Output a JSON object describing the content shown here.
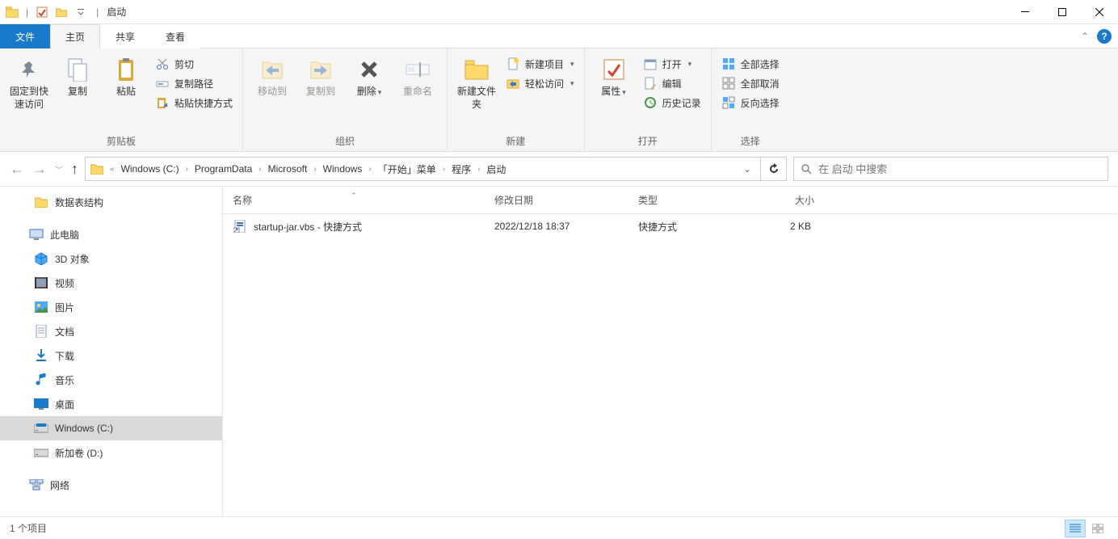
{
  "window": {
    "title": "启动"
  },
  "tabs": {
    "file": "文件",
    "home": "主页",
    "share": "共享",
    "view": "查看"
  },
  "ribbon": {
    "clipboard": {
      "group_label": "剪贴板",
      "pin": "固定到快速访问",
      "copy": "复制",
      "paste": "粘贴",
      "cut": "剪切",
      "copy_path": "复制路径",
      "paste_shortcut": "粘贴快捷方式"
    },
    "organize": {
      "group_label": "组织",
      "move_to": "移动到",
      "copy_to": "复制到",
      "delete": "删除",
      "rename": "重命名"
    },
    "new": {
      "group_label": "新建",
      "new_folder": "新建文件夹",
      "new_item": "新建项目",
      "easy_access": "轻松访问"
    },
    "open": {
      "group_label": "打开",
      "properties": "属性",
      "open": "打开",
      "edit": "编辑",
      "history": "历史记录"
    },
    "select": {
      "group_label": "选择",
      "select_all": "全部选择",
      "select_none": "全部取消",
      "invert": "反向选择"
    }
  },
  "breadcrumb": {
    "segments": [
      "Windows (C:)",
      "ProgramData",
      "Microsoft",
      "Windows",
      "「开始」菜单",
      "程序",
      "启动"
    ]
  },
  "search": {
    "placeholder": "在 启动 中搜索"
  },
  "sidebar": {
    "items": [
      {
        "label": "数据表结构",
        "icon": "folder"
      },
      {
        "label": "此电脑",
        "icon": "pc",
        "bold": true
      },
      {
        "label": "3D 对象",
        "icon": "3d"
      },
      {
        "label": "视频",
        "icon": "video"
      },
      {
        "label": "图片",
        "icon": "pictures"
      },
      {
        "label": "文档",
        "icon": "documents"
      },
      {
        "label": "下载",
        "icon": "downloads"
      },
      {
        "label": "音乐",
        "icon": "music"
      },
      {
        "label": "桌面",
        "icon": "desktop"
      },
      {
        "label": "Windows (C:)",
        "icon": "drive",
        "selected": true
      },
      {
        "label": "新加卷 (D:)",
        "icon": "drive"
      },
      {
        "label": "网络",
        "icon": "network",
        "bold": true
      }
    ]
  },
  "columns": {
    "name": "名称",
    "date": "修改日期",
    "type": "类型",
    "size": "大小"
  },
  "files": [
    {
      "name": "startup-jar.vbs - 快捷方式",
      "date": "2022/12/18 18:37",
      "type": "快捷方式",
      "size": "2 KB"
    }
  ],
  "status": {
    "count": "1 个项目"
  }
}
